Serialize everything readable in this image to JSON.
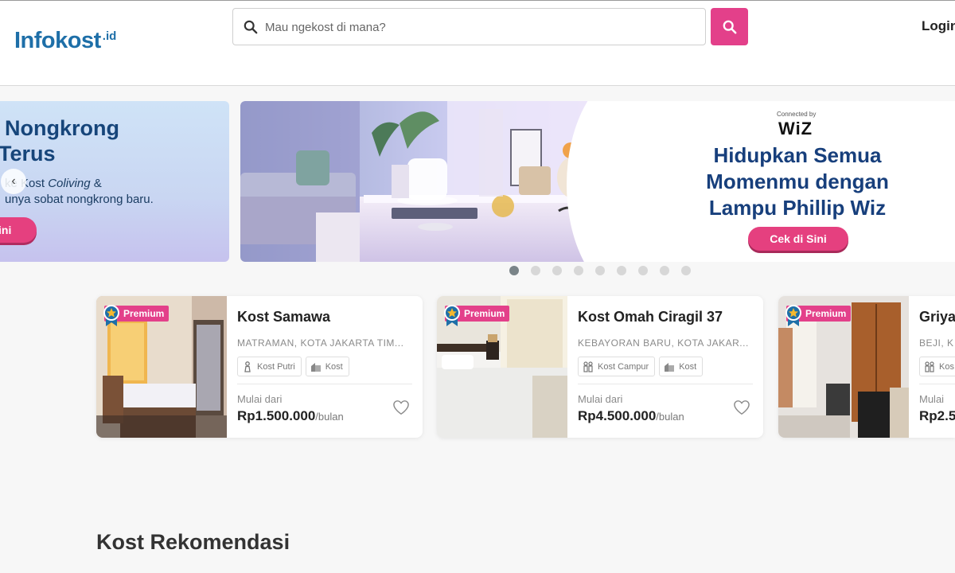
{
  "header": {
    "logo_text": "Infokost",
    "logo_suffix": ".id",
    "search_placeholder": "Mau ngekost di mana?",
    "login_label": "Login"
  },
  "banner_left": {
    "title_line1": "Nongkrong",
    "title_line2": "Terus",
    "subtitle_pre": "ke Kost ",
    "subtitle_em": "Coliving",
    "subtitle_post": " &",
    "subtitle_line2": "unya sobat nongkrong baru.",
    "button_label": "ini"
  },
  "banner_main": {
    "connected_by": "Connected by",
    "brand": "WiZ",
    "title": "Hidupkan Semua Momenmu dengan Lampu Phillip Wiz",
    "button_label": "Cek di Sini"
  },
  "carousel": {
    "dot_count": 9,
    "active_index": 0
  },
  "listings": [
    {
      "badge": "Premium",
      "name": "Kost Samawa",
      "location": "MATRAMAN, KOTA JAKARTA TIM...",
      "tags": [
        "Kost Putri",
        "Kost"
      ],
      "from_label": "Mulai dari",
      "price": "Rp1.500.000",
      "unit": "/bulan"
    },
    {
      "badge": "Premium",
      "name": "Kost Omah Ciragil 37",
      "location": "KEBAYORAN BARU, KOTA JAKAR...",
      "tags": [
        "Kost Campur",
        "Kost"
      ],
      "from_label": "Mulai dari",
      "price": "Rp4.500.000",
      "unit": "/bulan"
    },
    {
      "badge": "Premium",
      "name": "Griya",
      "location": "BEJI, K",
      "tags": [
        "Kos"
      ],
      "from_label": "Mulai",
      "price": "Rp2.5",
      "unit": ""
    }
  ],
  "section_title": "Kost Rekomendasi",
  "colors": {
    "brand_blue": "#1e6fa8",
    "accent_pink": "#e3408a",
    "banner_blue": "#173f7c"
  }
}
